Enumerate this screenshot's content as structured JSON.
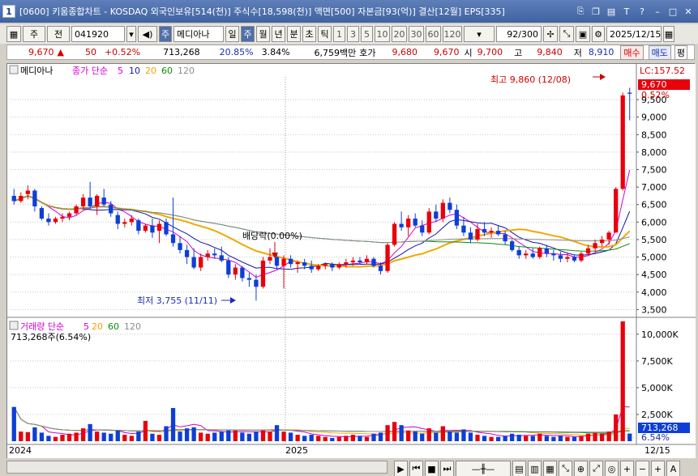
{
  "titlebar": {
    "window_number": "1",
    "title": "[0600] 키움종합차트 - KOSDAQ 외국인보유[514(천)] 주식수[18,598(천)] 액면[500] 자본금[93(억)] 결산[12월] EPS[335]"
  },
  "toolbar": {
    "type_btn": "주",
    "jeon_btn": "전",
    "code": "041920",
    "sel_badge": "주",
    "stock_name": "메디아나",
    "periods": [
      "일",
      "주",
      "월",
      "년"
    ],
    "active_period": "주",
    "units": [
      "분",
      "초",
      "틱"
    ],
    "intervals": [
      "1",
      "3",
      "5",
      "10",
      "20",
      "30",
      "60",
      "120"
    ],
    "count": "92/300",
    "date": "2025/12/15"
  },
  "quote": {
    "price": "9,670",
    "arrow": "▲",
    "change": "50",
    "change_pct": "+0.52%",
    "volume": "713,268",
    "ratio1": "20.85%",
    "ratio2": "3.84%",
    "amount": "6,759백만",
    "hoga_label": "호가",
    "hoga_sell": "9,680",
    "hoga_buy": "9,670",
    "open_label": "시",
    "open": "9,700",
    "high_label": "고",
    "high": "9,840",
    "low_label": "저",
    "low": "8,910",
    "buy_btn": "매수",
    "sell_btn": "매도",
    "eval_btn": "평"
  },
  "chart": {
    "price_legend_name": "메디아나",
    "ma_legend_prefix": "종가 단순",
    "ma_periods": [
      "5",
      "10",
      "20",
      "60",
      "120"
    ],
    "vol_legend_prefix": "거래량 단순",
    "vol_current_text": "713,268주(6.54%)",
    "lc_label": "LC:157.52",
    "current_price_tag": "9,670",
    "current_pct_tag": "0.52%",
    "vol_current_tag": "713,268",
    "vol_pct_tag": "6.54%",
    "high_annotation": "최고 9,860 (12/08)",
    "low_annotation": "최저 3,755 (11/11)",
    "dividend_annotation": "배당락(0.00%)",
    "date_labels": [
      "2024",
      "2025",
      "12/15"
    ],
    "colors": {
      "up": "#e8000b",
      "down": "#0d3fd6",
      "ma5": "#d200d2",
      "ma10": "#1414a8",
      "ma20": "#f0a800",
      "ma60": "#0a8a0a",
      "ma120": "#8c8c8c"
    }
  },
  "chart_data": {
    "type": "candlestick",
    "price_axis_ticks": [
      3500,
      4000,
      4500,
      5000,
      5500,
      6000,
      6500,
      7000,
      7500,
      8000,
      8500,
      9000,
      9500
    ],
    "volume_axis_ticks": [
      "2,500K",
      "5,000K",
      "7,500K",
      "10,000K"
    ],
    "volume_axis_values": [
      2500,
      5000,
      7500,
      10000
    ],
    "ylim_price": [
      3300,
      10150
    ],
    "ylim_volume": [
      0,
      11500
    ],
    "candles": [
      [
        6750,
        6950,
        6500,
        6600,
        3200
      ],
      [
        6600,
        6850,
        6550,
        6750,
        900
      ],
      [
        6800,
        7050,
        6650,
        6900,
        850
      ],
      [
        6900,
        6950,
        6300,
        6450,
        1300
      ],
      [
        6400,
        6450,
        6050,
        6100,
        800
      ],
      [
        6100,
        6250,
        5900,
        6000,
        500
      ],
      [
        6000,
        6150,
        5950,
        6100,
        400
      ],
      [
        6100,
        6250,
        6000,
        6150,
        600
      ],
      [
        6150,
        6300,
        6050,
        6250,
        700
      ],
      [
        6250,
        6500,
        6200,
        6450,
        800
      ],
      [
        6450,
        6800,
        6350,
        6700,
        1200
      ],
      [
        6700,
        7150,
        6350,
        6450,
        1600
      ],
      [
        6450,
        6800,
        6200,
        6750,
        900
      ],
      [
        6700,
        6950,
        6450,
        6500,
        800
      ],
      [
        6500,
        6600,
        6150,
        6250,
        700
      ],
      [
        6200,
        6300,
        5800,
        5950,
        1000
      ],
      [
        5950,
        6100,
        5850,
        6000,
        600
      ],
      [
        6000,
        6200,
        5900,
        6100,
        500
      ],
      [
        6050,
        6100,
        5650,
        5750,
        900
      ],
      [
        5750,
        5950,
        5700,
        5900,
        1900
      ],
      [
        5900,
        6100,
        5550,
        5700,
        700
      ],
      [
        5750,
        6050,
        5400,
        5950,
        600
      ],
      [
        6000,
        6100,
        5600,
        5650,
        1400
      ],
      [
        5650,
        6700,
        5300,
        5400,
        3100
      ],
      [
        5400,
        5600,
        5100,
        5200,
        900
      ],
      [
        5200,
        5350,
        4800,
        5000,
        1200
      ],
      [
        5000,
        5250,
        4650,
        4700,
        1300
      ],
      [
        4700,
        5100,
        4600,
        5000,
        800
      ],
      [
        5000,
        5200,
        4900,
        5100,
        700
      ],
      [
        5100,
        5250,
        4950,
        5050,
        800
      ],
      [
        5050,
        5300,
        4850,
        4900,
        900
      ],
      [
        4900,
        5000,
        4400,
        4500,
        1000
      ],
      [
        4500,
        4800,
        4350,
        4700,
        1000
      ],
      [
        4700,
        4750,
        4300,
        4400,
        800
      ],
      [
        4400,
        4550,
        4150,
        4350,
        700
      ],
      [
        4350,
        4500,
        3755,
        4150,
        900
      ],
      [
        4150,
        5000,
        4100,
        4900,
        1000
      ],
      [
        4900,
        5250,
        4800,
        5000,
        900
      ],
      [
        5000,
        5100,
        4650,
        4750,
        1500
      ],
      [
        4750,
        5050,
        4100,
        4950,
        900
      ],
      [
        4950,
        5050,
        4700,
        4800,
        800
      ],
      [
        4800,
        4900,
        4550,
        4850,
        600
      ],
      [
        4850,
        4950,
        4650,
        4750,
        500
      ],
      [
        4750,
        4900,
        4550,
        4650,
        600
      ],
      [
        4650,
        4800,
        4600,
        4750,
        500
      ],
      [
        4750,
        4850,
        4650,
        4800,
        400
      ],
      [
        4800,
        4850,
        4600,
        4700,
        300
      ],
      [
        4700,
        4850,
        4650,
        4800,
        400
      ],
      [
        4800,
        4950,
        4700,
        4850,
        500
      ],
      [
        4850,
        5000,
        4750,
        4900,
        600
      ],
      [
        4900,
        5000,
        4800,
        4850,
        500
      ],
      [
        4850,
        5050,
        4800,
        4950,
        400
      ],
      [
        4950,
        5000,
        4700,
        4750,
        700
      ],
      [
        4750,
        4850,
        4500,
        4600,
        800
      ],
      [
        4600,
        5400,
        4550,
        5350,
        1500
      ],
      [
        5350,
        6000,
        5300,
        5950,
        1800
      ],
      [
        5950,
        6300,
        5750,
        5850,
        1500
      ],
      [
        5850,
        6200,
        5600,
        6100,
        1000
      ],
      [
        6100,
        6250,
        5850,
        5900,
        900
      ],
      [
        5900,
        6050,
        5600,
        5700,
        700
      ],
      [
        5700,
        6400,
        5650,
        6300,
        1200
      ],
      [
        6300,
        6500,
        6000,
        6100,
        800
      ],
      [
        6100,
        6650,
        6000,
        6550,
        1400
      ],
      [
        6550,
        6700,
        6250,
        6350,
        900
      ],
      [
        6350,
        6500,
        5800,
        5900,
        800
      ],
      [
        5900,
        6150,
        5600,
        5700,
        1100
      ],
      [
        5700,
        5850,
        5400,
        5500,
        800
      ],
      [
        5500,
        5950,
        5450,
        5800,
        600
      ],
      [
        5800,
        6000,
        5600,
        5700,
        500
      ],
      [
        5700,
        5850,
        5550,
        5750,
        400
      ],
      [
        5750,
        5900,
        5600,
        5650,
        400
      ],
      [
        5650,
        5750,
        5350,
        5450,
        500
      ],
      [
        5450,
        5500,
        5150,
        5200,
        700
      ],
      [
        5200,
        5300,
        4950,
        5050,
        600
      ],
      [
        5050,
        5200,
        4950,
        5100,
        500
      ],
      [
        5100,
        5250,
        4950,
        5000,
        500
      ],
      [
        5000,
        5300,
        4950,
        5250,
        700
      ],
      [
        5250,
        5350,
        5000,
        5100,
        500
      ],
      [
        5100,
        5200,
        4900,
        5050,
        400
      ],
      [
        5050,
        5150,
        4850,
        4950,
        500
      ],
      [
        4950,
        5100,
        4850,
        5000,
        400
      ],
      [
        5000,
        5050,
        4850,
        4900,
        400
      ],
      [
        4900,
        5150,
        4850,
        5100,
        500
      ],
      [
        5100,
        5350,
        5050,
        5250,
        700
      ],
      [
        5250,
        5500,
        5150,
        5400,
        800
      ],
      [
        5400,
        5600,
        5300,
        5500,
        700
      ],
      [
        5500,
        5750,
        5350,
        5700,
        900
      ],
      [
        5700,
        7000,
        5700,
        6950,
        2500
      ],
      [
        6950,
        9700,
        6900,
        9620,
        11200
      ],
      [
        9700,
        9840,
        8910,
        9670,
        713
      ]
    ]
  }
}
